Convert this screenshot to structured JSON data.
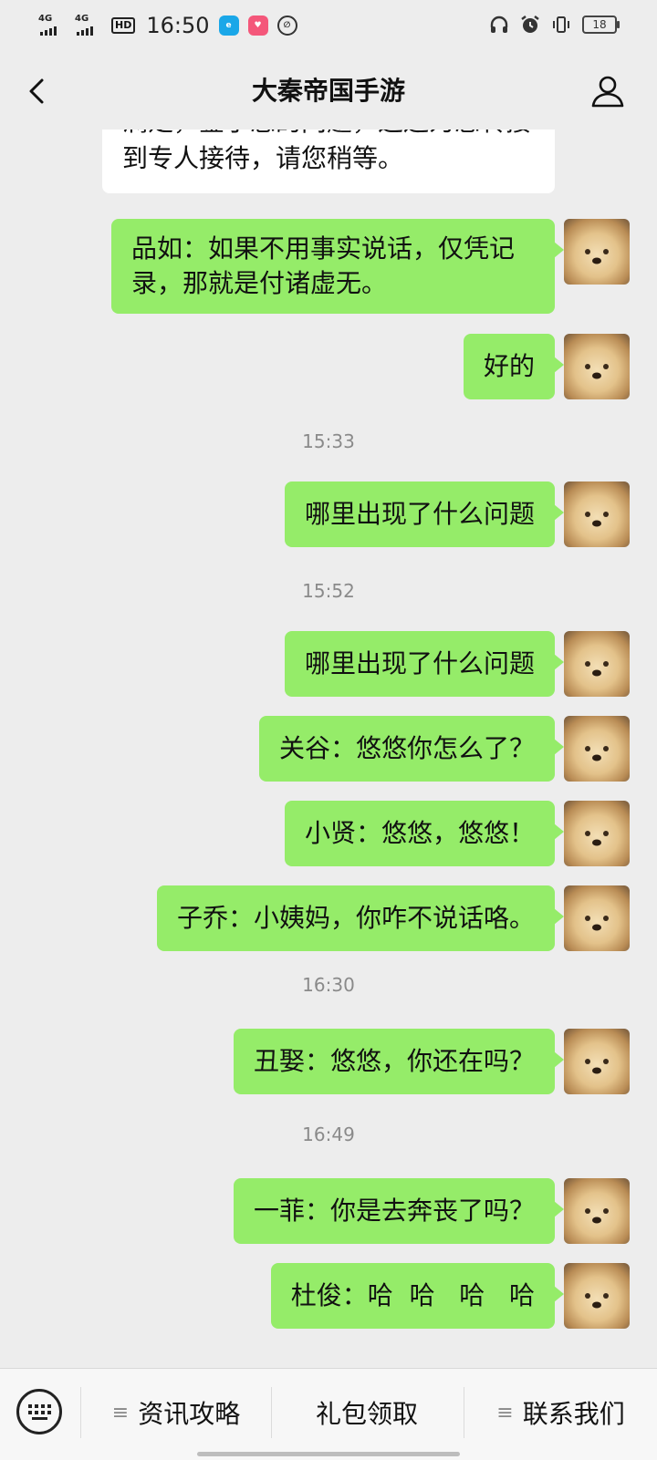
{
  "status_bar": {
    "signal_1": "4G",
    "signal_2": "4G",
    "hd": "HD",
    "time": "16:50",
    "battery": "18"
  },
  "header": {
    "title": "大秦帝国手游"
  },
  "messages": {
    "partial_reply": "满足，鉴于您的问题，这边为您转接到专人接待，请您稍等。",
    "m1": "品如：如果不用事实说话，仅凭记录，那就是付诸虚无。",
    "m2": "好的",
    "t1": "15:33",
    "m3": "哪里出现了什么问题",
    "t2": "15:52",
    "m4": "哪里出现了什么问题",
    "m5": "关谷：悠悠你怎么了？",
    "m6": "小贤：悠悠，悠悠！",
    "m7": "子乔：小姨妈，你咋不说话咯。",
    "t3": "16:30",
    "m8": "丑娶：悠悠，你还在吗？",
    "t4": "16:49",
    "m9": "一菲：你是去奔丧了吗？",
    "m10": "杜俊：哈  哈   哈   哈"
  },
  "bottom_menu": {
    "item1": "资讯攻略",
    "item2": "礼包领取",
    "item3": "联系我们"
  },
  "colors": {
    "background": "#ededed",
    "sent_bubble": "#95ec69",
    "received_bubble": "#ffffff",
    "timestamp": "#8a8a8a"
  }
}
